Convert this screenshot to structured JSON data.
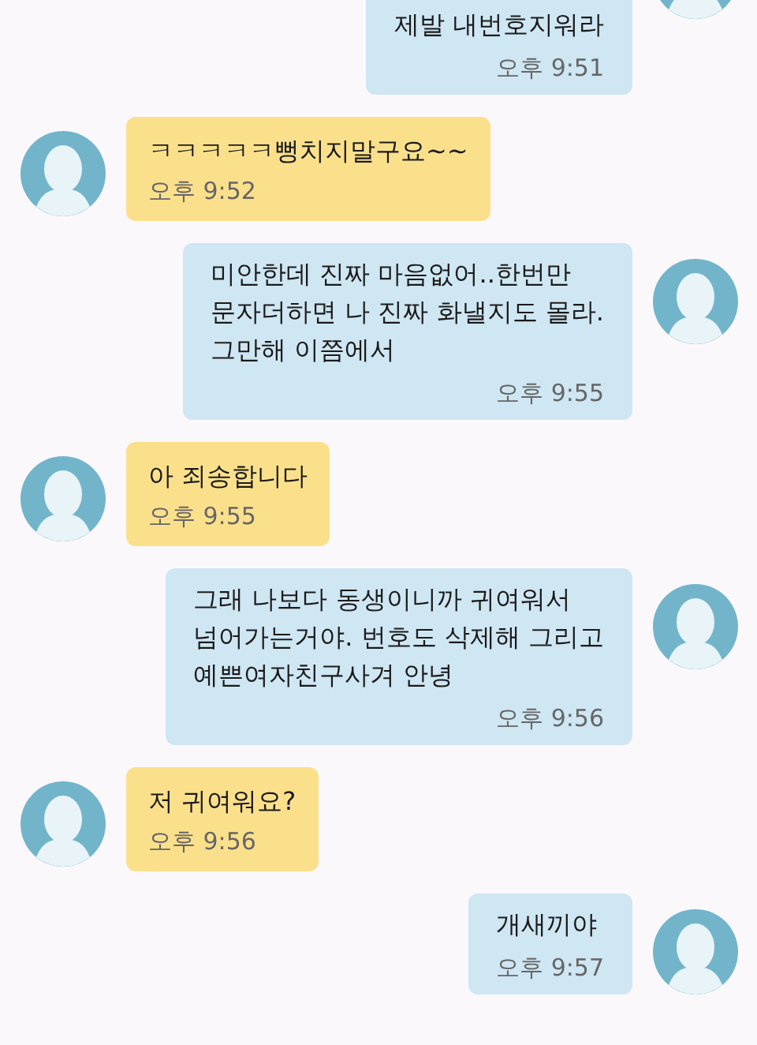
{
  "messages": [
    {
      "kind": "sent",
      "text": "제발 내번호지워라",
      "time": "오후 9:51"
    },
    {
      "kind": "received",
      "text": "ㅋㅋㅋㅋㅋ뻥치지말구요~~",
      "time": "오후 9:52"
    },
    {
      "kind": "sent",
      "text": "미안한데 진짜 마음없어..한번만\n문자더하면 나 진짜 화낼지도 몰라.\n그만해 이쯤에서",
      "time": "오후 9:55"
    },
    {
      "kind": "received",
      "text": "아 죄송합니다",
      "time": "오후 9:55"
    },
    {
      "kind": "sent",
      "text": "그래 나보다 동생이니까 귀여워서\n넘어가는거야. 번호도 삭제해 그리고\n예쁜여자친구사겨 안녕",
      "time": "오후 9:56"
    },
    {
      "kind": "received",
      "text": "저 귀여워요?",
      "time": "오후 9:56"
    },
    {
      "kind": "sent",
      "text": "개새끼야",
      "time": "오후 9:57"
    }
  ]
}
